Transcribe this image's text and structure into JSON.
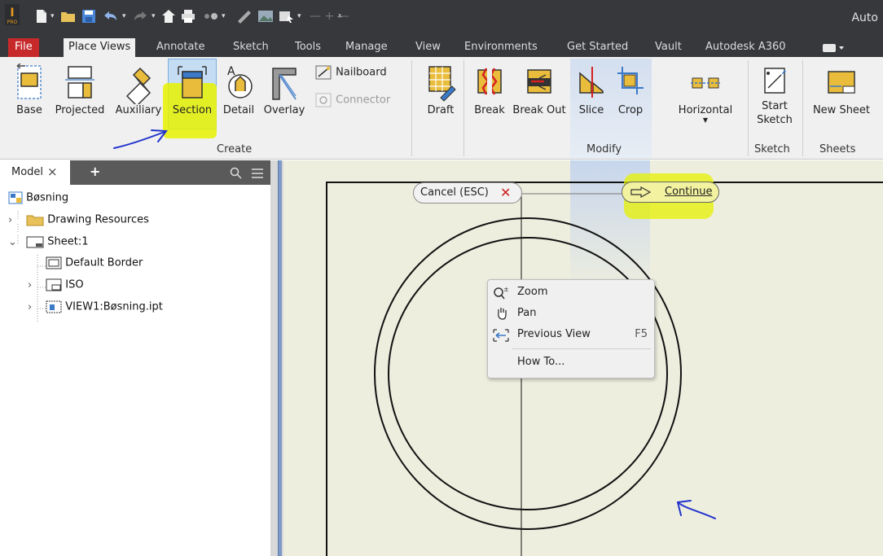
{
  "title_bar": {
    "app_title": "Auto"
  },
  "tabs": [
    "File",
    "Place Views",
    "Annotate",
    "Sketch",
    "Tools",
    "Manage",
    "View",
    "Environments",
    "Get Started",
    "Vault",
    "Autodesk A360"
  ],
  "ribbon": {
    "create": {
      "title": "Create",
      "buttons": [
        "Base",
        "Projected",
        "Auxiliary",
        "Section",
        "Detail",
        "Overlay"
      ],
      "small_buttons": [
        "Nailboard",
        "Connector"
      ]
    },
    "draft_label": "Draft",
    "modify": {
      "title": "Modify",
      "buttons": [
        "Break",
        "Break Out",
        "Slice",
        "Crop"
      ],
      "horizontal_label": "Horizontal"
    },
    "sketch": {
      "title": "Sketch",
      "start_sketch": [
        "Start",
        "Sketch"
      ]
    },
    "sheets": {
      "title": "Sheets",
      "new_sheet": "New Sheet"
    }
  },
  "browser": {
    "tab_label": "Model",
    "tree": [
      "Bøsning",
      "Drawing Resources",
      "Sheet:1",
      "Default Border",
      "ISO",
      "VIEW1:Bøsning.ipt"
    ]
  },
  "canvas": {
    "cancel_label": "Cancel (ESC)",
    "continue_label": "Continue",
    "context_menu": [
      {
        "label": "Zoom",
        "shortcut": ""
      },
      {
        "label": "Pan",
        "shortcut": ""
      },
      {
        "label": "Previous View",
        "shortcut": "F5"
      },
      {
        "label": "How To...",
        "shortcut": ""
      }
    ]
  },
  "colors": {
    "titlebar": "#36383c",
    "file_tab": "#c7292a",
    "ribbon_bg": "#f0f0f0",
    "canvas_bg": "#eeeedf",
    "highlight": "#e6f200",
    "annotation_arrow": "#2233cc"
  }
}
